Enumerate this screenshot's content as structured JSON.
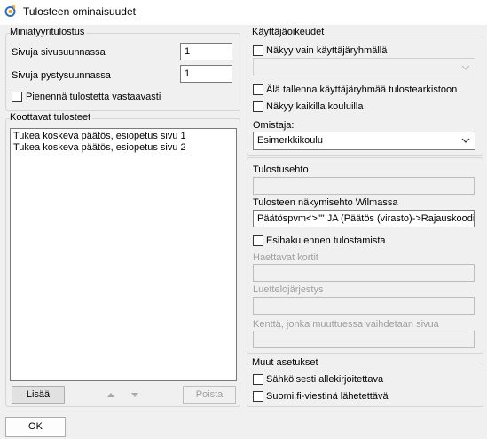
{
  "window": {
    "title": "Tulosteen ominaisuudet"
  },
  "thumbnail": {
    "legend": "Miniatyyritulostus",
    "horizontal_label": "Sivuja sivusuunnassa",
    "horizontal_value": "1",
    "vertical_label": "Sivuja pystysuunnassa",
    "vertical_value": "1",
    "shrink_label": "Pienennä tulostetta vastaavasti"
  },
  "compiled": {
    "legend": "Koottavat tulosteet",
    "items": [
      "Tukea koskeva päätös, esiopetus sivu 1",
      "Tukea koskeva päätös, esiopetus sivu 2"
    ],
    "add_label": "Lisää",
    "remove_label": "Poista"
  },
  "rights": {
    "legend": "Käyttäjäoikeudet",
    "group_only_label": "Näkyy vain käyttäjäryhmällä",
    "group_select_value": "",
    "dont_save_label": "Älä tallenna käyttäjäryhmää tulostearkistoon",
    "all_schools_label": "Näkyy kaikilla kouluilla",
    "owner_label": "Omistaja:",
    "owner_value": "Esimerkkikoulu"
  },
  "conditions": {
    "print_condition_label": "Tulostusehto",
    "print_condition_value": "",
    "visibility_label": "Tulosteen näkymisehto Wilmassa",
    "visibility_value": "Päätöspvm<>\"\" JA (Päätös (virasto)->Rajauskoodi",
    "pre_search_label": "Esihaku ennen tulostamista",
    "cards_label": "Haettavat kortit",
    "cards_value": "",
    "sort_label": "Luettelojärjestys",
    "sort_value": "",
    "page_field_label": "Kenttä, jonka muuttuessa vaihdetaan sivua",
    "page_field_value": ""
  },
  "other": {
    "legend": "Muut asetukset",
    "e_sign_label": "Sähköisesti allekirjoitettava",
    "suomifi_label": "Suomi.fi-viestinä lähetettävä"
  },
  "footer": {
    "ok_label": "OK"
  }
}
